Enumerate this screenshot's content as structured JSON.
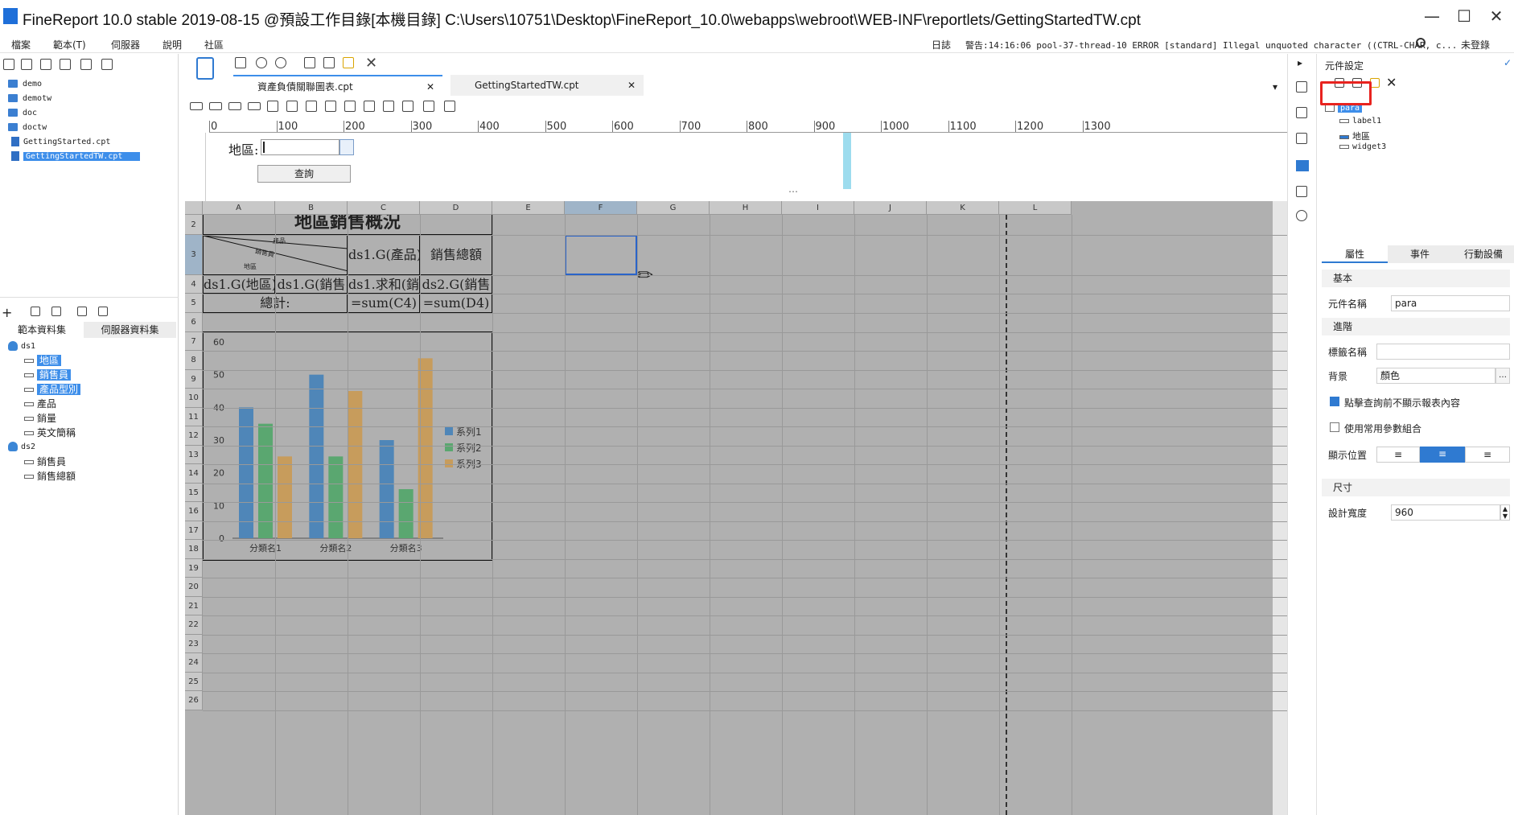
{
  "window": {
    "title": "FineReport 10.0 stable 2019-08-15 @預設工作目錄[本機目錄]    C:\\Users\\10751\\Desktop\\FineReport_10.0\\webapps\\webroot\\WEB-INF\\reportlets/GettingStartedTW.cpt",
    "min": "—",
    "max": "☐",
    "close": "✕"
  },
  "menu": {
    "items": [
      "檔案",
      "範本(T)",
      "伺服器",
      "說明",
      "社區"
    ],
    "log_label": "日誌",
    "log_text": "警告:14:16:06 pool-37-thread-10 ERROR [standard] Illegal unquoted character ((CTRL-CHAR, c...",
    "login": "未登錄"
  },
  "left": {
    "files": [
      "demo",
      "demotw",
      "doc",
      "doctw",
      "GettingStarted.cpt",
      "GettingStartedTW.cpt"
    ],
    "tabs": [
      "範本資料集",
      "伺服器資料集"
    ],
    "ds1": {
      "name": "ds1",
      "fields": [
        "地區",
        "銷售員",
        "產品型別",
        "產品",
        "銷量",
        "英文簡稱"
      ]
    },
    "ds2": {
      "name": "ds2",
      "fields": [
        "銷售員",
        "銷售總額"
      ]
    }
  },
  "center": {
    "tabs": [
      "資產負債關聯圖表.cpt",
      "GettingStartedTW.cpt"
    ],
    "ruler": [
      "0",
      "100",
      "200",
      "300",
      "400",
      "500",
      "600",
      "700",
      "800",
      "900",
      "1000",
      "1100",
      "1200",
      "1300"
    ],
    "param": {
      "label": "地區:",
      "button": "查詢"
    },
    "columns": [
      "A",
      "B",
      "C",
      "D",
      "E",
      "F",
      "G",
      "H",
      "I",
      "J",
      "K",
      "L"
    ],
    "rows": [
      "2",
      "3",
      "4",
      "5",
      "6",
      "7",
      "8",
      "9",
      "10",
      "11",
      "12",
      "13",
      "14",
      "15",
      "16",
      "17",
      "18",
      "19",
      "20",
      "21",
      "22",
      "23",
      "24",
      "25",
      "26"
    ],
    "cells": {
      "title": "地區銷售概況",
      "diag1": "產品",
      "diag2": "銷售員",
      "diag3": "地區",
      "c3": "ds1.G(產品)",
      "d3": "銷售總額",
      "a4": "ds1.G(地區)",
      "b4": "ds1.G(銷售",
      "c4": "ds1.求和(銷",
      "d4": "ds2.G(銷售",
      "ab5": "總計:",
      "c5": "=sum(C4)",
      "d5": "=sum(D4)"
    }
  },
  "chart_data": {
    "type": "bar",
    "categories": [
      "分類名1",
      "分類名2",
      "分類名3"
    ],
    "series": [
      {
        "name": "系列1",
        "values": [
          40,
          50,
          30
        ],
        "color": "#4f86b8"
      },
      {
        "name": "系列2",
        "values": [
          35,
          25,
          15
        ],
        "color": "#5aa770"
      },
      {
        "name": "系列3",
        "values": [
          25,
          45,
          55
        ],
        "color": "#c79c5c"
      }
    ],
    "yticks": [
      "0",
      "10",
      "20",
      "30",
      "40",
      "50",
      "60"
    ],
    "ylim": [
      0,
      60
    ],
    "legend": "right"
  },
  "right": {
    "header": "元件設定",
    "tree": [
      "para",
      "label1",
      "地區",
      "widget3"
    ],
    "tabs": [
      "屬性",
      "事件",
      "行動設備"
    ],
    "basic": "基本",
    "name_label": "元件名稱",
    "name_value": "para",
    "advanced": "進階",
    "tag_label": "標籤名稱",
    "bg_label": "背景",
    "bg_value": "顏色",
    "chk1": "點擊查詢前不顯示報表內容",
    "chk2": "使用常用參數組合",
    "pos_label": "顯示位置",
    "size": "尺寸",
    "width_label": "設計寬度",
    "width_value": "960"
  },
  "colors": {
    "accent": "#3d8eea",
    "highlight": "#e8231f",
    "sheet": "#b0b0b0"
  }
}
